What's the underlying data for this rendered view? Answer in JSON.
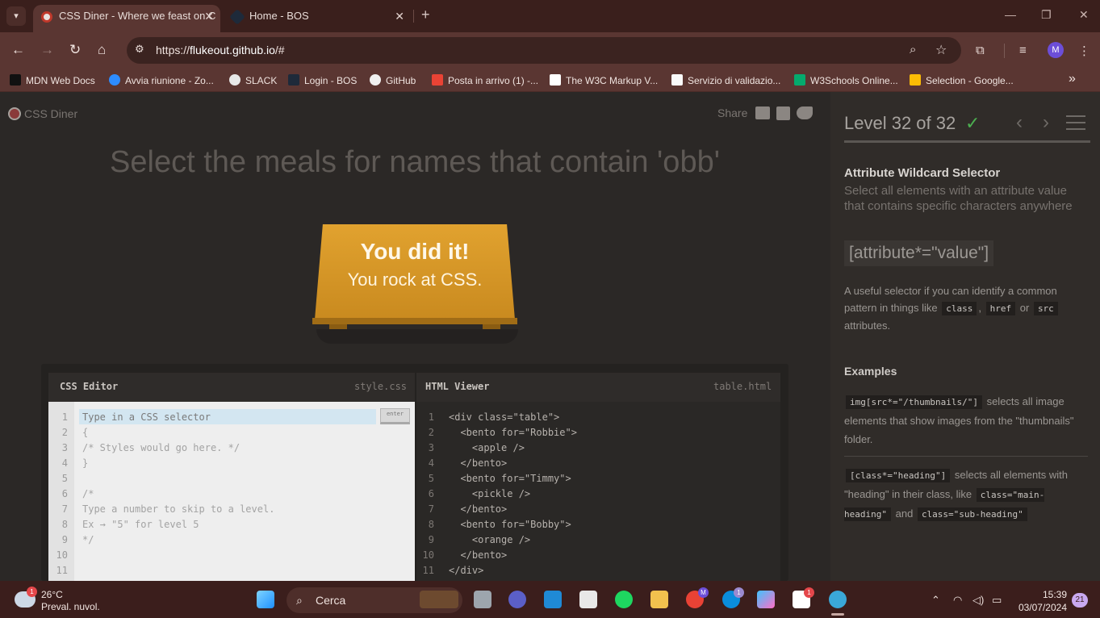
{
  "browser": {
    "tabs": [
      {
        "title": "CSS Diner - Where we feast on C",
        "active": true
      },
      {
        "title": "Home - BOS",
        "active": false
      }
    ],
    "url_prefix": "https://",
    "url_host": "flukeout.github.io",
    "url_path": "/#",
    "profile_initial": "M",
    "bookmarks": [
      {
        "label": "MDN Web Docs",
        "icon": "mdn-icon"
      },
      {
        "label": "Avvia riunione - Zo...",
        "icon": "zoom-icon"
      },
      {
        "label": "SLACK",
        "icon": "globe-icon"
      },
      {
        "label": "Login - BOS",
        "icon": "bos-icon"
      },
      {
        "label": "GitHub",
        "icon": "github-icon"
      },
      {
        "label": "Posta in arrivo (1) -...",
        "icon": "gmail-icon"
      },
      {
        "label": "The W3C Markup V...",
        "icon": "w3c-icon"
      },
      {
        "label": "Servizio di validazio...",
        "icon": "validator-icon"
      },
      {
        "label": "W3Schools Online...",
        "icon": "w3schools-icon"
      },
      {
        "label": "Selection - Google...",
        "icon": "google-icon"
      }
    ],
    "bookmarks_more": "»"
  },
  "header": {
    "logo_text": "CSS Diner",
    "share_label": "Share"
  },
  "order": "Select the meals for names that contain 'obb'",
  "win": {
    "line1": "You did it!",
    "line2": "You rock at CSS."
  },
  "css_editor": {
    "title": "CSS Editor",
    "filename": "style.css",
    "placeholder": "Type in a CSS selector",
    "enter_label": "enter",
    "line_numbers": [
      "1",
      "2",
      "3",
      "4",
      "5",
      "6",
      "7",
      "8",
      "9",
      "10",
      "11"
    ],
    "lines": [
      "{",
      "/* Styles would go here. */",
      "}",
      "",
      "/*",
      "Type a number to skip to a level.",
      "Ex → \"5\" for level 5",
      "*/"
    ]
  },
  "html_viewer": {
    "title": "HTML Viewer",
    "filename": "table.html",
    "line_numbers": [
      "1",
      "2",
      "3",
      "4",
      "5",
      "6",
      "7",
      "8",
      "9",
      "10",
      "11"
    ],
    "lines": [
      "<div class=\"table\">",
      "  <bento for=\"Robbie\">",
      "    <apple />",
      "  </bento>",
      "  <bento for=\"Timmy\">",
      "    <pickle />",
      "  </bento>",
      "  <bento for=\"Bobby\">",
      "    <orange />",
      "  </bento>",
      "</div>"
    ]
  },
  "sidebar": {
    "level": "Level 32 of 32",
    "check": "✓",
    "title": "Attribute Wildcard Selector",
    "subtitle": "Select all elements with an attribute value that contains specific characters anywhere",
    "syntax": "[attribute*=\"value\"]",
    "hint_pre": "A useful selector if you can identify a common pattern in things like",
    "hint_codes": [
      "class",
      "href",
      "src"
    ],
    "hint_comma": ",",
    "hint_or": "or",
    "hint_post": "attributes.",
    "examples_title": "Examples",
    "example1_code": "img[src*=\"/thumbnails/\"]",
    "example1_text": "selects all image elements that show images from the \"thumbnails\" folder.",
    "example2_code": "[class*=\"heading\"]",
    "example2_text1": "selects all elements with \"heading\" in their class, like",
    "example2_code2": "class=\"main-heading\"",
    "example2_and": "and",
    "example2_code3": "class=\"sub-heading\""
  },
  "taskbar": {
    "temperature": "26°C",
    "weather": "Preval. nuvol.",
    "weather_badge": "1",
    "search_label": "Cerca",
    "time": "15:39",
    "date": "03/07/2024",
    "notifications": "21",
    "skype_badge": "1",
    "slack_badge": "1",
    "chrome_badge": "M"
  }
}
